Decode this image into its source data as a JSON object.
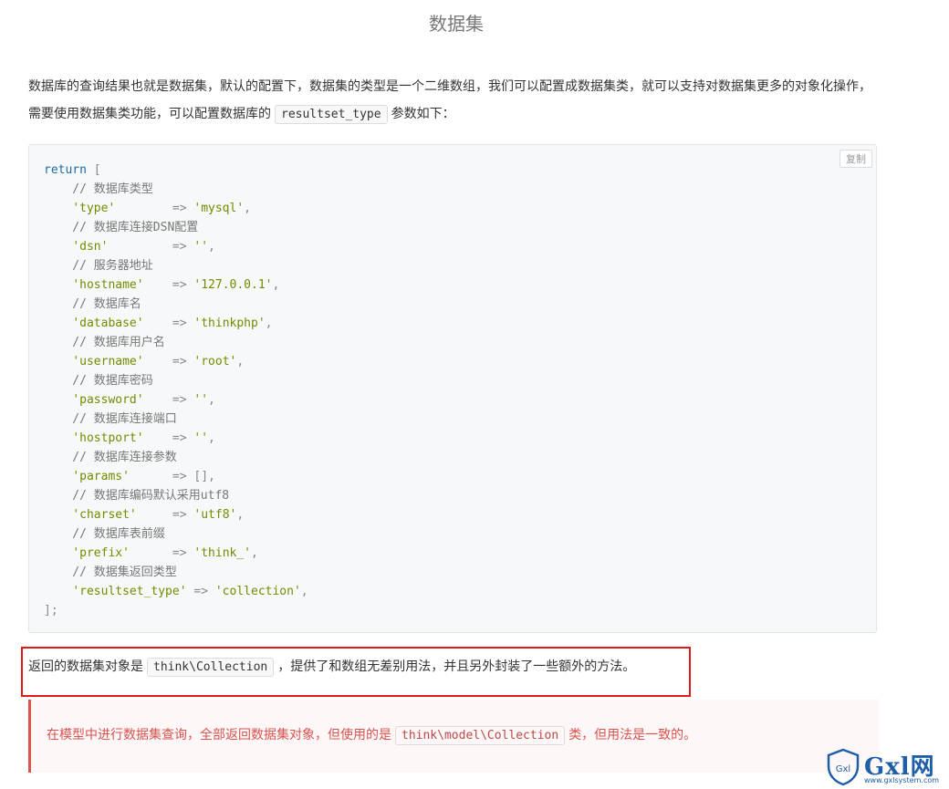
{
  "title": "数据集",
  "intro": {
    "text_before": "数据库的查询结果也就是数据集，默认的配置下，数据集的类型是一个二维数组，我们可以配置成数据集类，就可以支持对数据集更多的对象化操作，需要使用数据集类功能，可以配置数据库的",
    "code": "resultset_type",
    "text_after": "参数如下："
  },
  "code_block": {
    "copy_label": "复制",
    "return_kw": "return",
    "open": " [",
    "close": "];",
    "entries": [
      {
        "comment": "// 数据库类型",
        "key": "'type'",
        "pad": "        ",
        "value": "'mysql'"
      },
      {
        "comment": "// 数据库连接DSN配置",
        "key": "'dsn'",
        "pad": "         ",
        "value": "''"
      },
      {
        "comment": "// 服务器地址",
        "key": "'hostname'",
        "pad": "    ",
        "value": "'127.0.0.1'"
      },
      {
        "comment": "// 数据库名",
        "key": "'database'",
        "pad": "    ",
        "value": "'thinkphp'"
      },
      {
        "comment": "// 数据库用户名",
        "key": "'username'",
        "pad": "    ",
        "value": "'root'"
      },
      {
        "comment": "// 数据库密码",
        "key": "'password'",
        "pad": "    ",
        "value": "''"
      },
      {
        "comment": "// 数据库连接端口",
        "key": "'hostport'",
        "pad": "    ",
        "value": "''"
      },
      {
        "comment": "// 数据库连接参数",
        "key": "'params'",
        "pad": "      ",
        "value": "[]"
      },
      {
        "comment": "// 数据库编码默认采用utf8",
        "key": "'charset'",
        "pad": "     ",
        "value": "'utf8'"
      },
      {
        "comment": "// 数据库表前缀",
        "key": "'prefix'",
        "pad": "      ",
        "value": "'think_'"
      },
      {
        "comment": "// 数据集返回类型",
        "key": "'resultset_type'",
        "pad": " ",
        "value": "'collection'"
      }
    ]
  },
  "result": {
    "text_before": "返回的数据集对象是",
    "code": "think\\Collection",
    "text_after": "，提供了和数组无差别用法，并且另外封装了一些额外的方法。"
  },
  "alert": {
    "text_before": "在模型中进行数据集查询，全部返回数据集对象，但使用的是",
    "code": "think\\model\\Collection",
    "text_after": "类，但用法是一致的。"
  },
  "logo": {
    "brand": "Gxl网",
    "url": "www.gxlsystem.com",
    "shield_text": "Gxl"
  },
  "colors": {
    "highlight_border": "#e01a1a",
    "alert_color": "#d9534f",
    "keyword": "#1c6aa8",
    "string": "#718c00"
  }
}
